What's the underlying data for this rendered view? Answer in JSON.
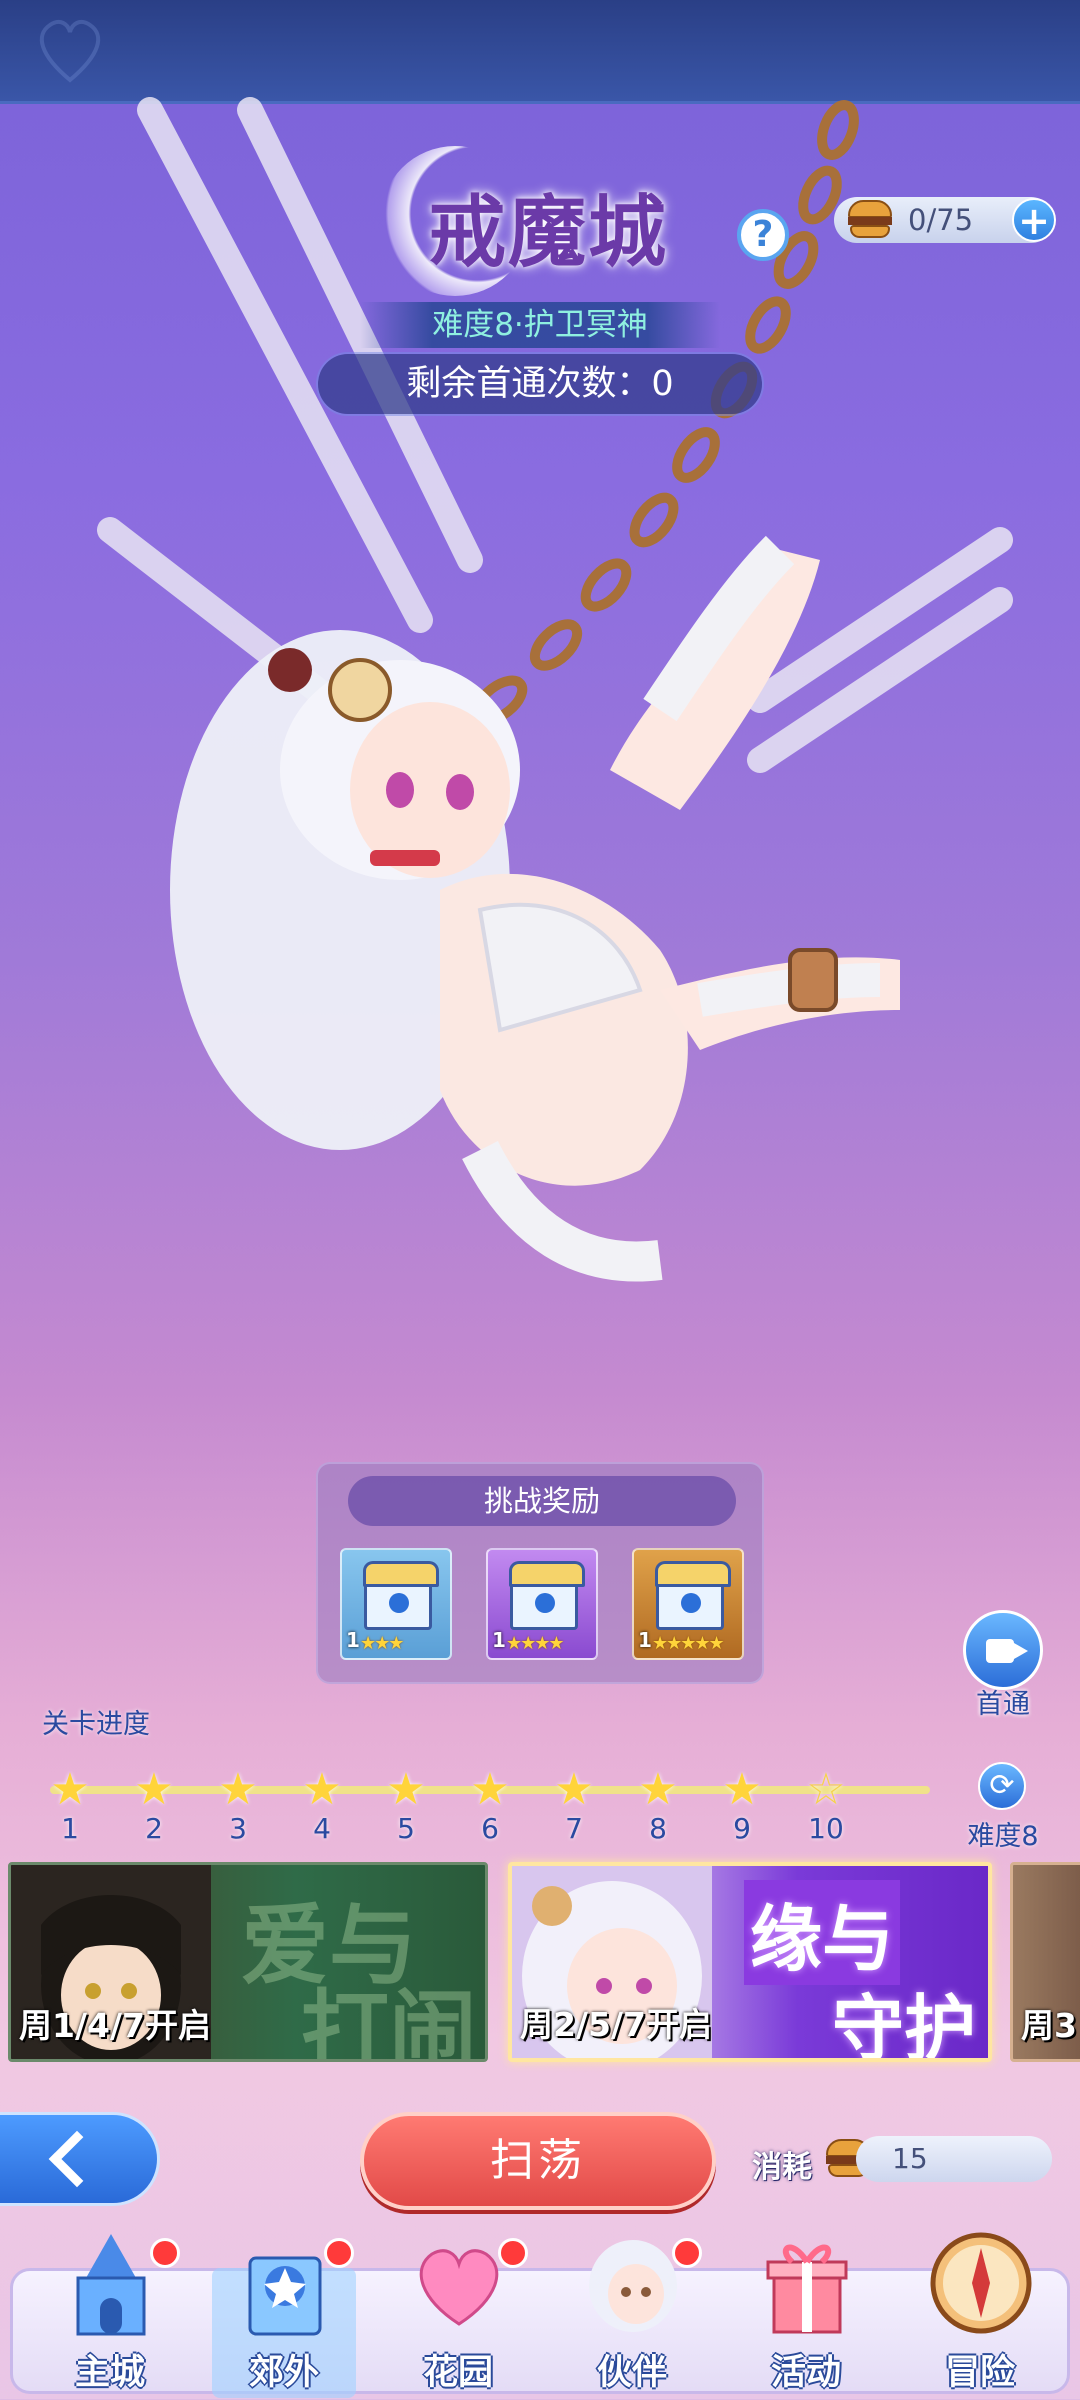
{
  "header": {
    "title": "戒魔城",
    "difficulty": "难度8·护卫冥神",
    "remaining_first_clears": "剩余首通次数：0"
  },
  "stamina": {
    "value": "0/75",
    "icon": "burger-icon",
    "add_label": "+"
  },
  "help_label": "?",
  "rewards": {
    "title": "挑战奖励",
    "items": [
      {
        "count": "1",
        "stars": "★★★",
        "rarity": "blue"
      },
      {
        "count": "1",
        "stars": "★★★★",
        "rarity": "purple"
      },
      {
        "count": "1",
        "stars": "★★★★★",
        "rarity": "gold"
      }
    ]
  },
  "first_clear_video": {
    "label": "首通",
    "icon": "video-camera-icon"
  },
  "progress": {
    "label": "关卡进度",
    "stages": [
      "1",
      "2",
      "3",
      "4",
      "5",
      "6",
      "7",
      "8",
      "9",
      "10"
    ],
    "completed": 9
  },
  "difficulty_switch": {
    "label": "难度8",
    "icon": "refresh-icon"
  },
  "banners": [
    {
      "title_line1": "爱与",
      "title_line2": "打闹",
      "days": "周1/4/7开启",
      "selected": false
    },
    {
      "title_line1": "缘与",
      "title_line2": "守护",
      "days": "周2/5/7开启",
      "selected": true
    },
    {
      "title_line1": "",
      "title_line2": "",
      "days": "周3",
      "selected": false
    }
  ],
  "actions": {
    "sweep_label": "扫荡",
    "cost_label": "消耗",
    "cost_value": "15"
  },
  "nav": [
    {
      "label": "主城",
      "icon": "castle-icon",
      "badge": true
    },
    {
      "label": "郊外",
      "icon": "outskirts-gate-icon",
      "badge": true
    },
    {
      "label": "花园",
      "icon": "heart-garden-icon",
      "badge": true
    },
    {
      "label": "伙伴",
      "icon": "companion-portrait-icon",
      "badge": true
    },
    {
      "label": "活动",
      "icon": "gift-box-icon",
      "badge": false
    },
    {
      "label": "冒险",
      "icon": "compass-icon",
      "badge": false
    }
  ],
  "colors": {
    "accent_blue": "#2c6ed8",
    "sweep_red": "#e24a48",
    "star_gold": "#ffd43a"
  }
}
